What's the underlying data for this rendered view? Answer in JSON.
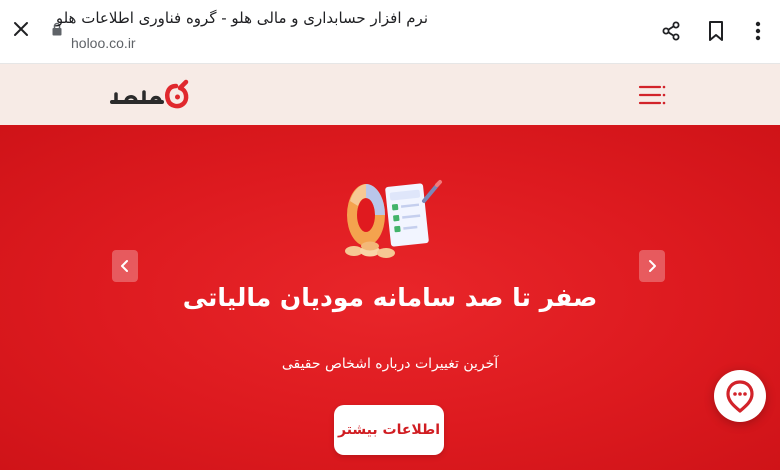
{
  "browser": {
    "page_title": "نرم افزار حسابداری و مالی هلو - گروه فناوری اطلاعات هلو",
    "url": "holoo.co.ir",
    "icons": {
      "close": "close-icon",
      "lock": "lock-icon",
      "share": "share-icon",
      "bookmark": "bookmark-icon",
      "more": "more-vertical-icon"
    }
  },
  "site_header": {
    "logo_text": "هلو",
    "menu_icon": "menu-icon"
  },
  "hero": {
    "title": "صفر تا صد سامانه مودیان مالیاتی",
    "subtitle": "آخرین تغییرات درباره اشخاص حقیقی",
    "cta_label": "اطلاعات بیشتر",
    "prev_icon": "chevron-left-icon",
    "next_icon": "chevron-right-icon"
  },
  "colors": {
    "brand_red": "#e01a1f",
    "header_bg": "#f7ebe6",
    "cta_text": "#d01d22"
  },
  "chat": {
    "icon": "chat-icon"
  }
}
